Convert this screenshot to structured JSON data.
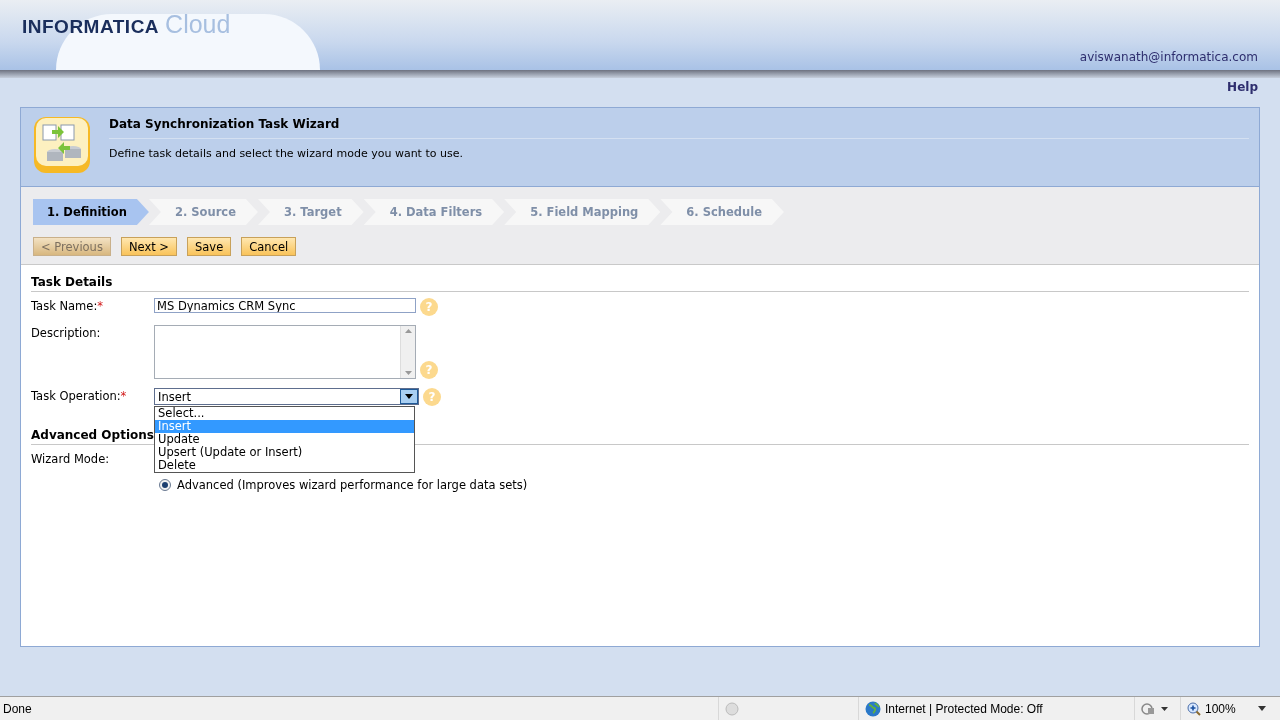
{
  "header": {
    "brand": "INFORMATICA",
    "product": "Cloud",
    "user": "aviswanath@informatica.com"
  },
  "help_link": "Help",
  "wizard": {
    "title": "Data Synchronization Task Wizard",
    "subtitle": "Define task details and select the wizard mode you want to use.",
    "steps": [
      {
        "label": "1. Definition",
        "selected": true
      },
      {
        "label": "2. Source",
        "selected": false
      },
      {
        "label": "3. Target",
        "selected": false
      },
      {
        "label": "4. Data Filters",
        "selected": false
      },
      {
        "label": "5. Field Mapping",
        "selected": false
      },
      {
        "label": "6. Schedule",
        "selected": false
      }
    ],
    "buttons": [
      {
        "label": "< Previous",
        "disabled": true
      },
      {
        "label": "Next >",
        "disabled": false
      },
      {
        "label": "Save",
        "disabled": false
      },
      {
        "label": "Cancel",
        "disabled": false
      }
    ]
  },
  "task_details": {
    "heading": "Task Details",
    "task_name": {
      "label": "Task Name:",
      "required_mark": "*",
      "value": "MS Dynamics CRM Sync",
      "help": "?"
    },
    "description": {
      "label": "Description:",
      "help": "?"
    },
    "task_operation": {
      "label": "Task Operation:",
      "required_mark": "*",
      "value": "Insert",
      "help": "?",
      "expanded": true,
      "options": [
        {
          "label": "Select...",
          "selected": false
        },
        {
          "label": "Insert",
          "selected": true
        },
        {
          "label": "Update",
          "selected": false
        },
        {
          "label": "Upsert (Update or Insert)",
          "selected": false
        },
        {
          "label": "Delete",
          "selected": false
        }
      ]
    }
  },
  "advanced_options": {
    "heading": "Advanced Options",
    "wizard_mode_label": "Wizard Mode:",
    "modes": [
      {
        "label": "Advanced (Improves wizard performance for large data sets)",
        "selected": true
      }
    ]
  },
  "status_bar": {
    "status": "Done",
    "zone": "Internet | Protected Mode: Off",
    "zoom": "100%"
  }
}
